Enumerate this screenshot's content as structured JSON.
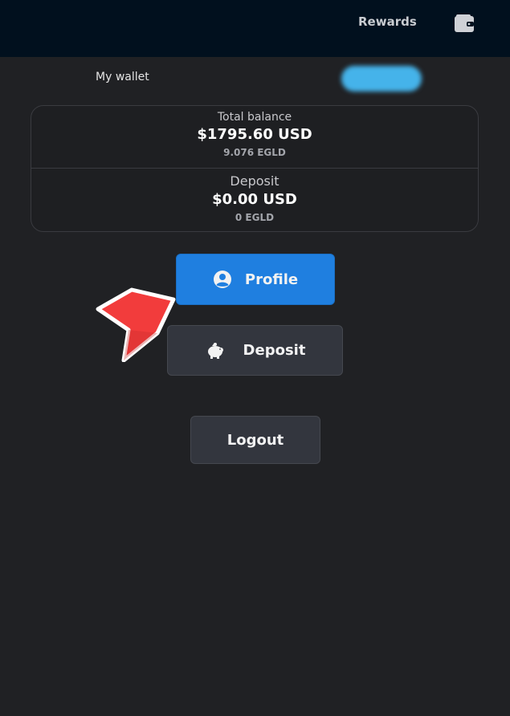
{
  "header": {
    "rewards_label": "Rewards",
    "wallet_icon": "wallet-icon"
  },
  "wallet": {
    "title": "My wallet"
  },
  "balance": {
    "total_label": "Total balance",
    "total_usd": "$1795.60 USD",
    "total_egld": "9.076 EGLD",
    "deposit_label": "Deposit",
    "deposit_usd": "$0.00 USD",
    "deposit_egld": "0 EGLD"
  },
  "actions": {
    "profile_label": "Profile",
    "profile_icon": "user-circle-icon",
    "deposit_label": "Deposit",
    "deposit_icon": "piggy-bank-icon",
    "logout_label": "Logout"
  },
  "colors": {
    "primary": "#1f7fe0",
    "background": "#202124",
    "header_bg": "#01101e",
    "secondary_button": "#33363e",
    "annotation_arrow": "#f23c3c"
  }
}
